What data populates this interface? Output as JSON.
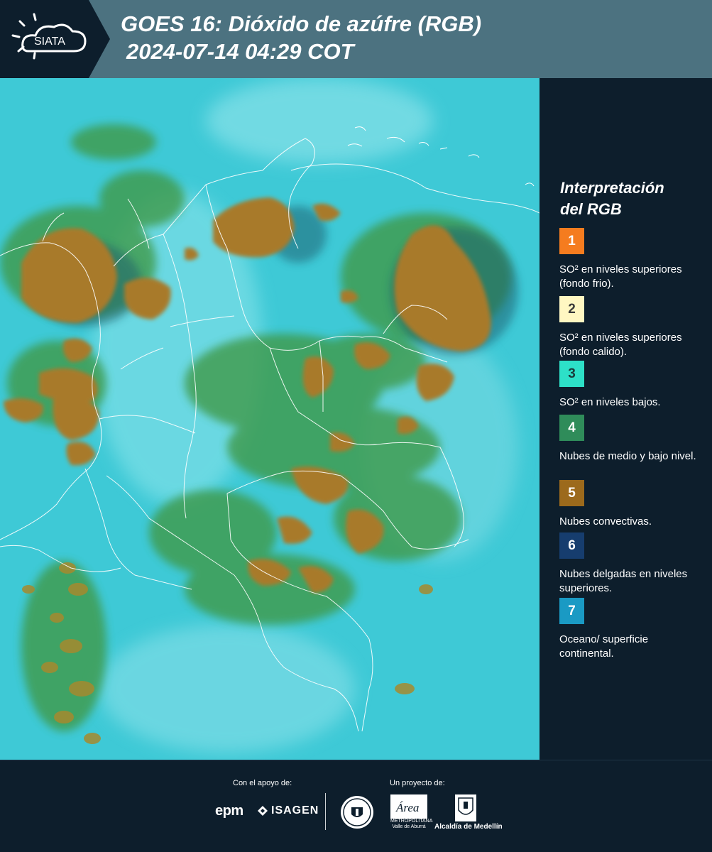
{
  "header": {
    "logo_text": "SIATA",
    "title_line1": "GOES 16: Dióxido de azúfre (RGB)",
    "title_line2": "2024-07-14 04:29 COT",
    "background_color": "#4c7280"
  },
  "legend": {
    "title_line1": "Interpretación",
    "title_line2": "del RGB",
    "items": [
      {
        "number": "1",
        "color": "#f57c1f",
        "text_color": "#ffffff",
        "label": "SO² en niveles superiores (fondo frio)."
      },
      {
        "number": "2",
        "color": "#fff7c2",
        "text_color": "#222222",
        "label": "SO² en niveles superiores (fondo calido)."
      },
      {
        "number": "3",
        "color": "#2de0c8",
        "text_color": "#1a3a3a",
        "label": "SO² en niveles bajos."
      },
      {
        "number": "4",
        "color": "#2f8c5a",
        "text_color": "#ffffff",
        "label": "Nubes de medio y bajo nivel."
      },
      {
        "number": "5",
        "color": "#9c6a1c",
        "text_color": "#ffffff",
        "label": "Nubes convectivas."
      },
      {
        "number": "6",
        "color": "#163d6e",
        "text_color": "#ffffff",
        "label": "Nubes delgadas en niveles superiores."
      },
      {
        "number": "7",
        "color": "#1a9ac4",
        "text_color": "#ffffff",
        "label": "Oceano/ superficie continental."
      }
    ]
  },
  "footer": {
    "support_label": "Con el apoyo de:",
    "project_label": "Un proyecto de:",
    "epm_logo": "epm",
    "isagen_logo": "ISAGEN",
    "area_logo": "Área",
    "area_subtitle": "METROPOLITANA Valle de Aburrá",
    "alcaldia_logo": "Alcaldía de Medellín"
  },
  "map": {
    "background_color": "#3ec9d6",
    "cloud_color": "#a87a2c",
    "vegetation_color": "#3f9a4a",
    "border_color": "#ffffff"
  }
}
